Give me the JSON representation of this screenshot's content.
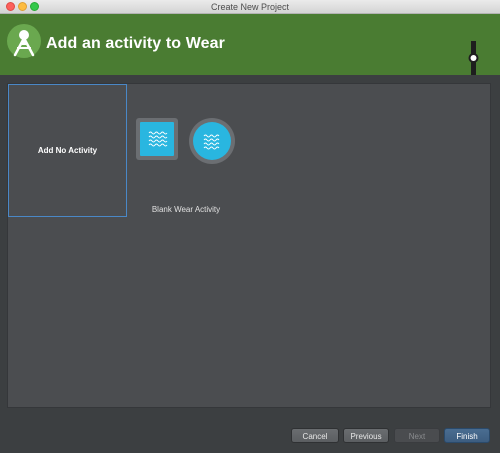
{
  "window": {
    "title": "Create New Project"
  },
  "header": {
    "title": "Add an activity to Wear",
    "logo_icon": "android-studio-icon",
    "device_icon": "watch-icon"
  },
  "activities": [
    {
      "label": "Add No Activity",
      "selected": true
    },
    {
      "label": "Blank Wear Activity",
      "selected": false
    }
  ],
  "buttons": {
    "cancel": "Cancel",
    "previous": "Previous",
    "next": "Next",
    "finish": "Finish"
  },
  "colors": {
    "header": "#4a7c32",
    "accent": "#29b6e0",
    "selection": "#4a88c7"
  }
}
